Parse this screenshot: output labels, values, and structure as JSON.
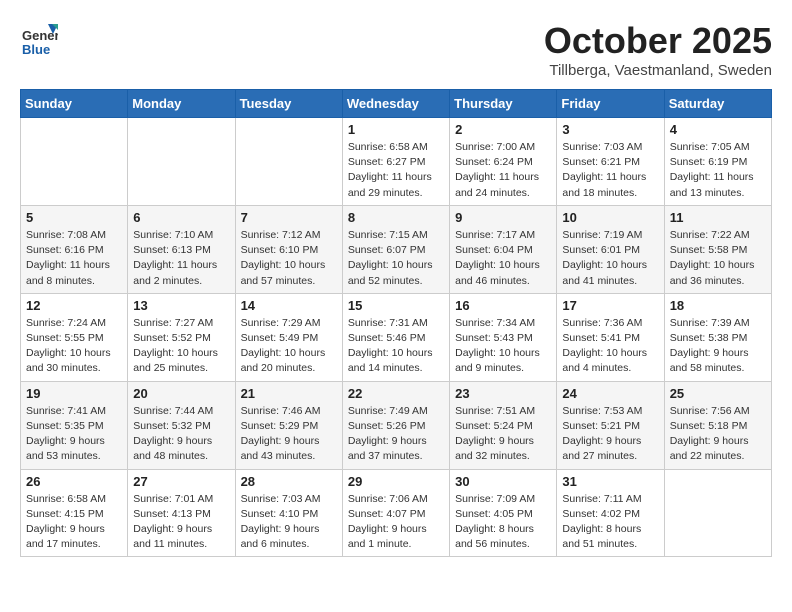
{
  "header": {
    "logo": {
      "general": "General",
      "blue": "Blue"
    },
    "title": "October 2025",
    "location": "Tillberga, Vaestmanland, Sweden"
  },
  "weekdays": [
    "Sunday",
    "Monday",
    "Tuesday",
    "Wednesday",
    "Thursday",
    "Friday",
    "Saturday"
  ],
  "weeks": [
    [
      {
        "day": "",
        "info": ""
      },
      {
        "day": "",
        "info": ""
      },
      {
        "day": "",
        "info": ""
      },
      {
        "day": "1",
        "info": "Sunrise: 6:58 AM\nSunset: 6:27 PM\nDaylight: 11 hours\nand 29 minutes."
      },
      {
        "day": "2",
        "info": "Sunrise: 7:00 AM\nSunset: 6:24 PM\nDaylight: 11 hours\nand 24 minutes."
      },
      {
        "day": "3",
        "info": "Sunrise: 7:03 AM\nSunset: 6:21 PM\nDaylight: 11 hours\nand 18 minutes."
      },
      {
        "day": "4",
        "info": "Sunrise: 7:05 AM\nSunset: 6:19 PM\nDaylight: 11 hours\nand 13 minutes."
      }
    ],
    [
      {
        "day": "5",
        "info": "Sunrise: 7:08 AM\nSunset: 6:16 PM\nDaylight: 11 hours\nand 8 minutes."
      },
      {
        "day": "6",
        "info": "Sunrise: 7:10 AM\nSunset: 6:13 PM\nDaylight: 11 hours\nand 2 minutes."
      },
      {
        "day": "7",
        "info": "Sunrise: 7:12 AM\nSunset: 6:10 PM\nDaylight: 10 hours\nand 57 minutes."
      },
      {
        "day": "8",
        "info": "Sunrise: 7:15 AM\nSunset: 6:07 PM\nDaylight: 10 hours\nand 52 minutes."
      },
      {
        "day": "9",
        "info": "Sunrise: 7:17 AM\nSunset: 6:04 PM\nDaylight: 10 hours\nand 46 minutes."
      },
      {
        "day": "10",
        "info": "Sunrise: 7:19 AM\nSunset: 6:01 PM\nDaylight: 10 hours\nand 41 minutes."
      },
      {
        "day": "11",
        "info": "Sunrise: 7:22 AM\nSunset: 5:58 PM\nDaylight: 10 hours\nand 36 minutes."
      }
    ],
    [
      {
        "day": "12",
        "info": "Sunrise: 7:24 AM\nSunset: 5:55 PM\nDaylight: 10 hours\nand 30 minutes."
      },
      {
        "day": "13",
        "info": "Sunrise: 7:27 AM\nSunset: 5:52 PM\nDaylight: 10 hours\nand 25 minutes."
      },
      {
        "day": "14",
        "info": "Sunrise: 7:29 AM\nSunset: 5:49 PM\nDaylight: 10 hours\nand 20 minutes."
      },
      {
        "day": "15",
        "info": "Sunrise: 7:31 AM\nSunset: 5:46 PM\nDaylight: 10 hours\nand 14 minutes."
      },
      {
        "day": "16",
        "info": "Sunrise: 7:34 AM\nSunset: 5:43 PM\nDaylight: 10 hours\nand 9 minutes."
      },
      {
        "day": "17",
        "info": "Sunrise: 7:36 AM\nSunset: 5:41 PM\nDaylight: 10 hours\nand 4 minutes."
      },
      {
        "day": "18",
        "info": "Sunrise: 7:39 AM\nSunset: 5:38 PM\nDaylight: 9 hours\nand 58 minutes."
      }
    ],
    [
      {
        "day": "19",
        "info": "Sunrise: 7:41 AM\nSunset: 5:35 PM\nDaylight: 9 hours\nand 53 minutes."
      },
      {
        "day": "20",
        "info": "Sunrise: 7:44 AM\nSunset: 5:32 PM\nDaylight: 9 hours\nand 48 minutes."
      },
      {
        "day": "21",
        "info": "Sunrise: 7:46 AM\nSunset: 5:29 PM\nDaylight: 9 hours\nand 43 minutes."
      },
      {
        "day": "22",
        "info": "Sunrise: 7:49 AM\nSunset: 5:26 PM\nDaylight: 9 hours\nand 37 minutes."
      },
      {
        "day": "23",
        "info": "Sunrise: 7:51 AM\nSunset: 5:24 PM\nDaylight: 9 hours\nand 32 minutes."
      },
      {
        "day": "24",
        "info": "Sunrise: 7:53 AM\nSunset: 5:21 PM\nDaylight: 9 hours\nand 27 minutes."
      },
      {
        "day": "25",
        "info": "Sunrise: 7:56 AM\nSunset: 5:18 PM\nDaylight: 9 hours\nand 22 minutes."
      }
    ],
    [
      {
        "day": "26",
        "info": "Sunrise: 6:58 AM\nSunset: 4:15 PM\nDaylight: 9 hours\nand 17 minutes."
      },
      {
        "day": "27",
        "info": "Sunrise: 7:01 AM\nSunset: 4:13 PM\nDaylight: 9 hours\nand 11 minutes."
      },
      {
        "day": "28",
        "info": "Sunrise: 7:03 AM\nSunset: 4:10 PM\nDaylight: 9 hours\nand 6 minutes."
      },
      {
        "day": "29",
        "info": "Sunrise: 7:06 AM\nSunset: 4:07 PM\nDaylight: 9 hours\nand 1 minute."
      },
      {
        "day": "30",
        "info": "Sunrise: 7:09 AM\nSunset: 4:05 PM\nDaylight: 8 hours\nand 56 minutes."
      },
      {
        "day": "31",
        "info": "Sunrise: 7:11 AM\nSunset: 4:02 PM\nDaylight: 8 hours\nand 51 minutes."
      },
      {
        "day": "",
        "info": ""
      }
    ]
  ]
}
